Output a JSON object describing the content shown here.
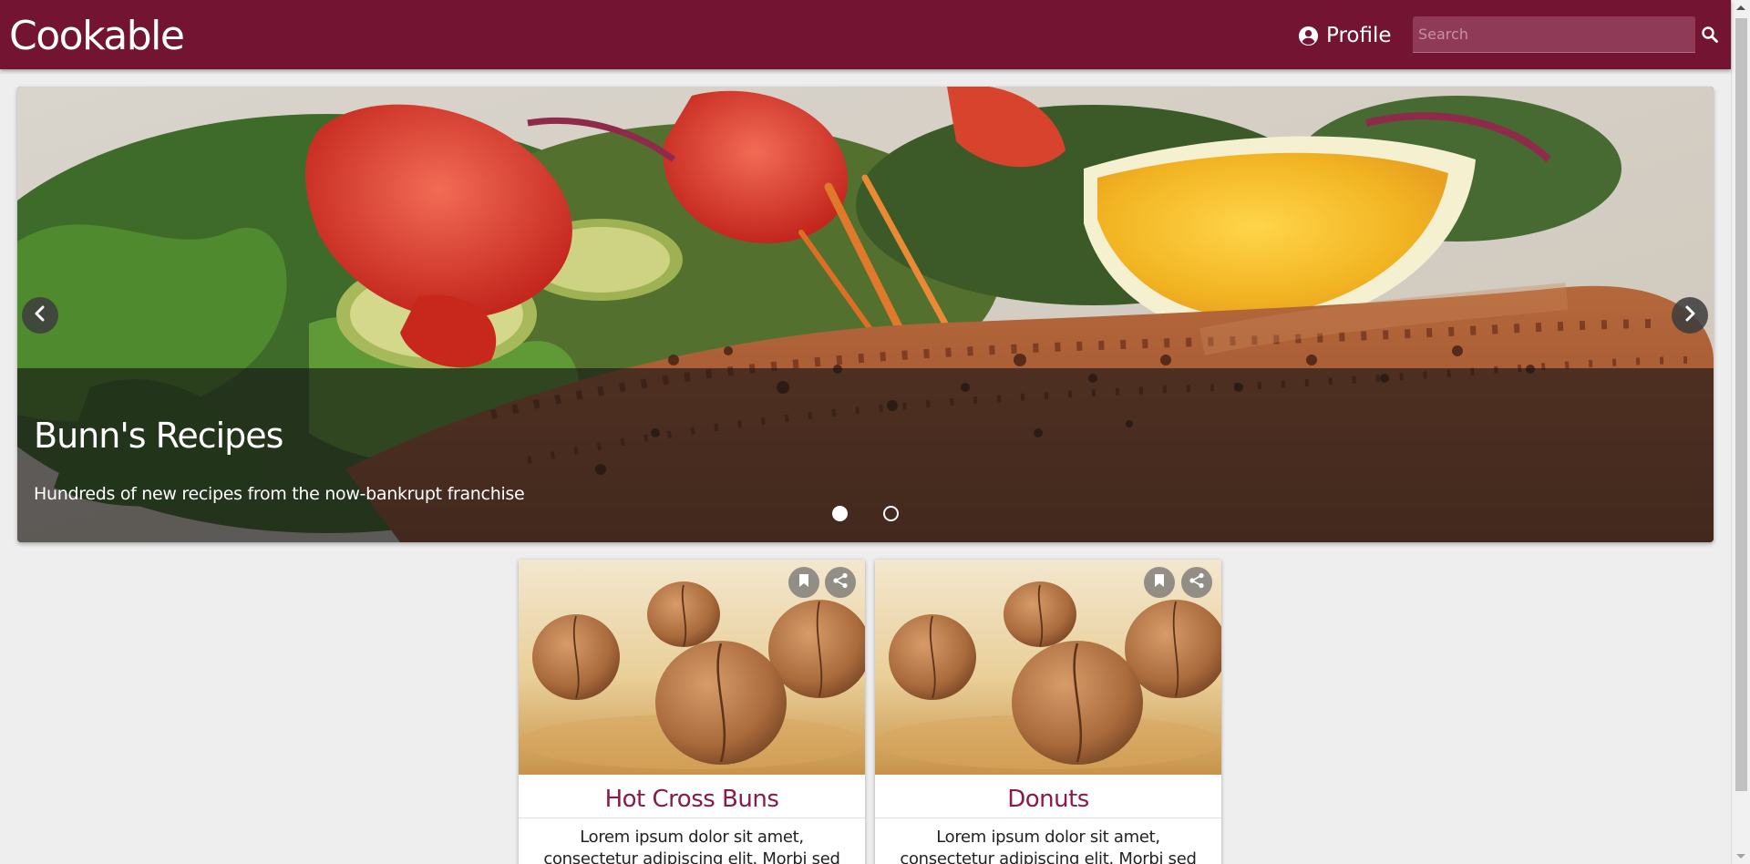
{
  "app": {
    "brand": "Cookable"
  },
  "header": {
    "profile_label": "Profile",
    "search_placeholder": "Search",
    "search_value": ""
  },
  "icons": {
    "profile": "account-circle-icon",
    "search": "search-icon",
    "prev": "chevron-left-icon",
    "next": "chevron-right-icon",
    "bookmark": "bookmark-icon",
    "share": "share-icon"
  },
  "colors": {
    "brand": "#721432",
    "card_title": "#8a1a48",
    "background": "#eeeeee"
  },
  "carousel": {
    "title": "Bunn's Recipes",
    "subtitle": "Hundreds of new recipes from the now-bankrupt franchise",
    "slide_count": 2,
    "active_slide": 1
  },
  "recipes": [
    {
      "title": "Hot Cross Buns",
      "description": "Lorem ipsum dolor sit amet, consectetur adipiscing elit. Morbi sed elit id lorem"
    },
    {
      "title": "Donuts",
      "description": "Lorem ipsum dolor sit amet, consectetur adipiscing elit. Morbi sed elit id lorem"
    }
  ]
}
